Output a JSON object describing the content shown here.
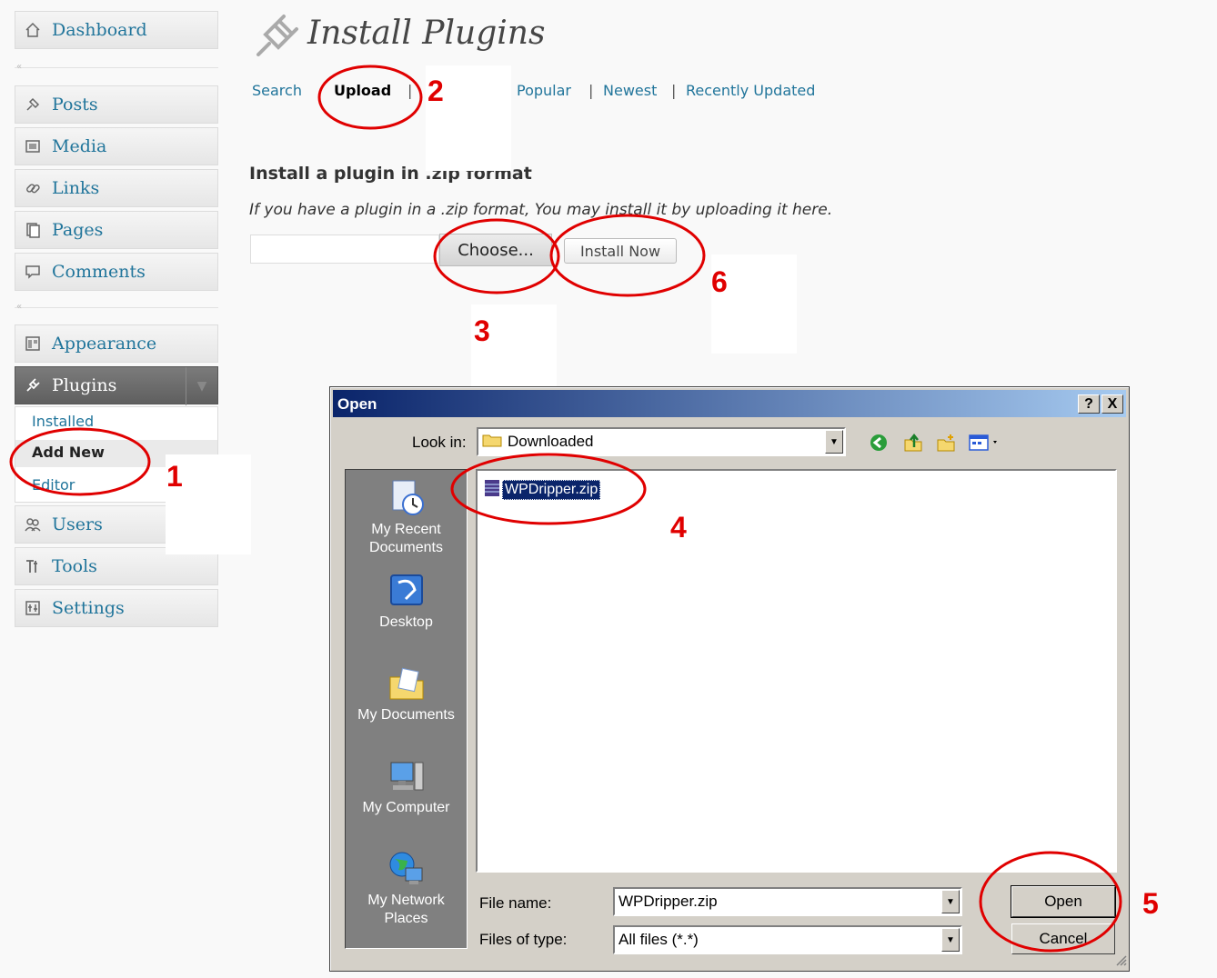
{
  "sidebar": {
    "dashboard": "Dashboard",
    "posts": "Posts",
    "media": "Media",
    "links": "Links",
    "pages": "Pages",
    "comments": "Comments",
    "appearance": "Appearance",
    "plugins": "Plugins",
    "plugins_sub": [
      "Installed",
      "Add New",
      "Editor"
    ],
    "users": "Users",
    "tools": "Tools",
    "settings": "Settings",
    "collapse_glyph": "«"
  },
  "main": {
    "title": "Install Plugins",
    "tabs": [
      "Search",
      "Upload",
      "Popular",
      "Newest",
      "Recently Updated"
    ],
    "section_title": "Install a plugin in .zip format",
    "description": "If you have a plugin in a .zip format, You may install it by uploading it here.",
    "choose_label": "Choose...",
    "install_label": "Install Now"
  },
  "dialog": {
    "title": "Open",
    "help_btn": "?",
    "close_btn": "X",
    "look_in_label": "Look in:",
    "look_in_value": "Downloaded",
    "places": [
      "My Recent Documents",
      "Desktop",
      "My Documents",
      "My Computer",
      "My Network Places"
    ],
    "files": [
      "WPDripper.zip"
    ],
    "file_name_label": "File name:",
    "file_name_value": "WPDripper.zip",
    "file_type_label": "Files of type:",
    "file_type_value": "All files (*.*)",
    "open_label": "Open",
    "cancel_label": "Cancel"
  },
  "annotations": [
    "1",
    "2",
    "3",
    "4",
    "5",
    "6"
  ],
  "colors": {
    "link": "#21759b",
    "annotation": "#e00000",
    "titlebar_start": "#0a246a",
    "titlebar_end": "#a6caf0",
    "dialog_face": "#d4d0c8"
  }
}
